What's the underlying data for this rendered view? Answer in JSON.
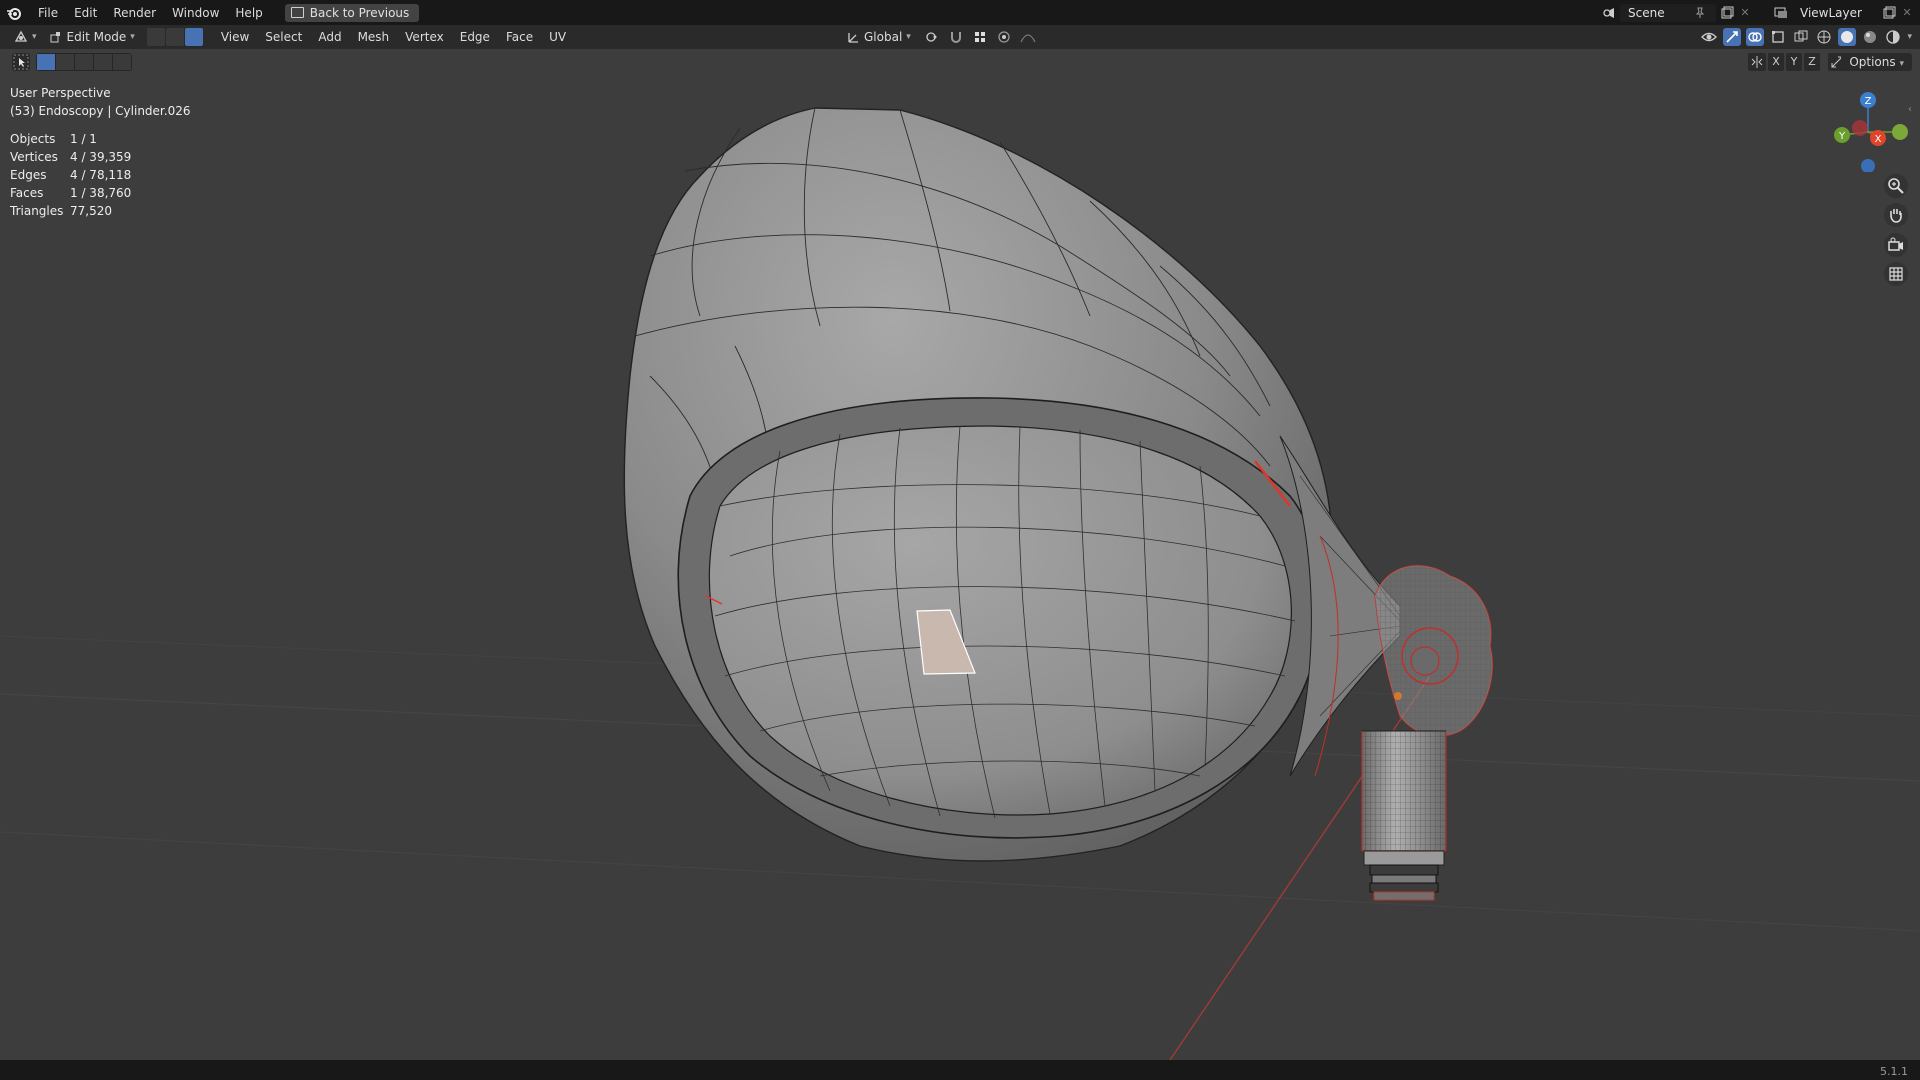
{
  "menubar": {
    "items": [
      "File",
      "Edit",
      "Render",
      "Window",
      "Help"
    ],
    "back_button": "Back to Previous",
    "scene_label": "Scene",
    "viewlayer_label": "ViewLayer"
  },
  "header": {
    "mode": "Edit Mode",
    "menus": [
      "View",
      "Select",
      "Add",
      "Mesh",
      "Vertex",
      "Edge",
      "Face",
      "UV"
    ],
    "transform_orientation": "Global"
  },
  "toolrow": {
    "axes": [
      "X",
      "Y",
      "Z"
    ],
    "options_label": "Options"
  },
  "overlay": {
    "view_name": "User Perspective",
    "object_info": "(53) Endoscopy | Cylinder.026",
    "stats": [
      {
        "label": "Objects",
        "value": "1 / 1"
      },
      {
        "label": "Vertices",
        "value": "4 / 39,359"
      },
      {
        "label": "Edges",
        "value": "4 / 78,118"
      },
      {
        "label": "Faces",
        "value": "1 / 38,760"
      },
      {
        "label": "Triangles",
        "value": "77,520"
      }
    ]
  },
  "gizmo": {
    "axes": [
      "Z",
      "Y",
      "X"
    ]
  },
  "statusbar": {
    "version": "5.1.1"
  },
  "colors": {
    "accent": "#4772b3",
    "background": "#3d3d3d",
    "topbar": "#181818",
    "header": "#2a2a2a",
    "selected_face": "#c9b8ae",
    "selected_edge": "#e0352b",
    "axis_x": "#e0452b",
    "axis_y": "#6a9f2d",
    "axis_z": "#3a7fd0"
  },
  "icons": {
    "app": "blender-logo-icon",
    "editor_type": "3d-viewport-icon",
    "navigation": [
      "zoom-icon",
      "hand-pan-icon",
      "camera-icon",
      "grid-ortho-icon"
    ]
  }
}
